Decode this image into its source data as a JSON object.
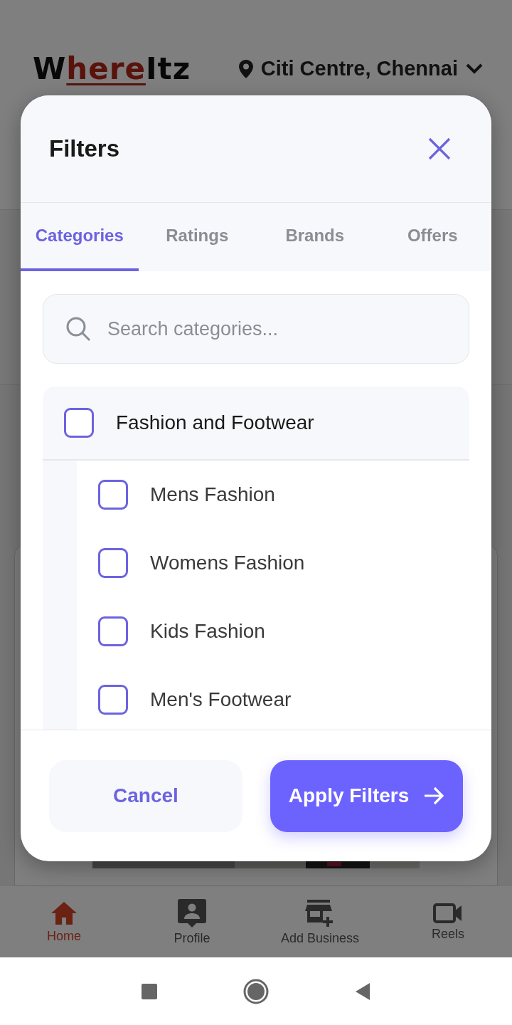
{
  "header": {
    "logo": [
      {
        "text": "W",
        "accent": false
      },
      {
        "text": "here",
        "accent": true
      },
      {
        "text": "Itz",
        "accent": false
      }
    ],
    "location": "Citi Centre, Chennai"
  },
  "modal": {
    "title": "Filters",
    "tabs": [
      {
        "label": "Categories",
        "selected": true
      },
      {
        "label": "Ratings",
        "selected": false
      },
      {
        "label": "Brands",
        "selected": false
      },
      {
        "label": "Offers",
        "selected": false
      }
    ],
    "search": {
      "placeholder": "Search categories..."
    },
    "categories": [
      {
        "label": "Fashion and Footwear",
        "checked": false,
        "children": [
          {
            "label": "Mens Fashion",
            "checked": false
          },
          {
            "label": "Womens Fashion",
            "checked": false
          },
          {
            "label": "Kids Fashion",
            "checked": false
          },
          {
            "label": "Men's Footwear",
            "checked": false
          }
        ]
      }
    ],
    "cancel": "Cancel",
    "apply": "Apply Filters"
  },
  "bottom_nav": [
    {
      "label": "Home",
      "selected": true
    },
    {
      "label": "Profile",
      "selected": false
    },
    {
      "label": "Add Business",
      "selected": false
    },
    {
      "label": "Reels",
      "selected": false
    }
  ]
}
